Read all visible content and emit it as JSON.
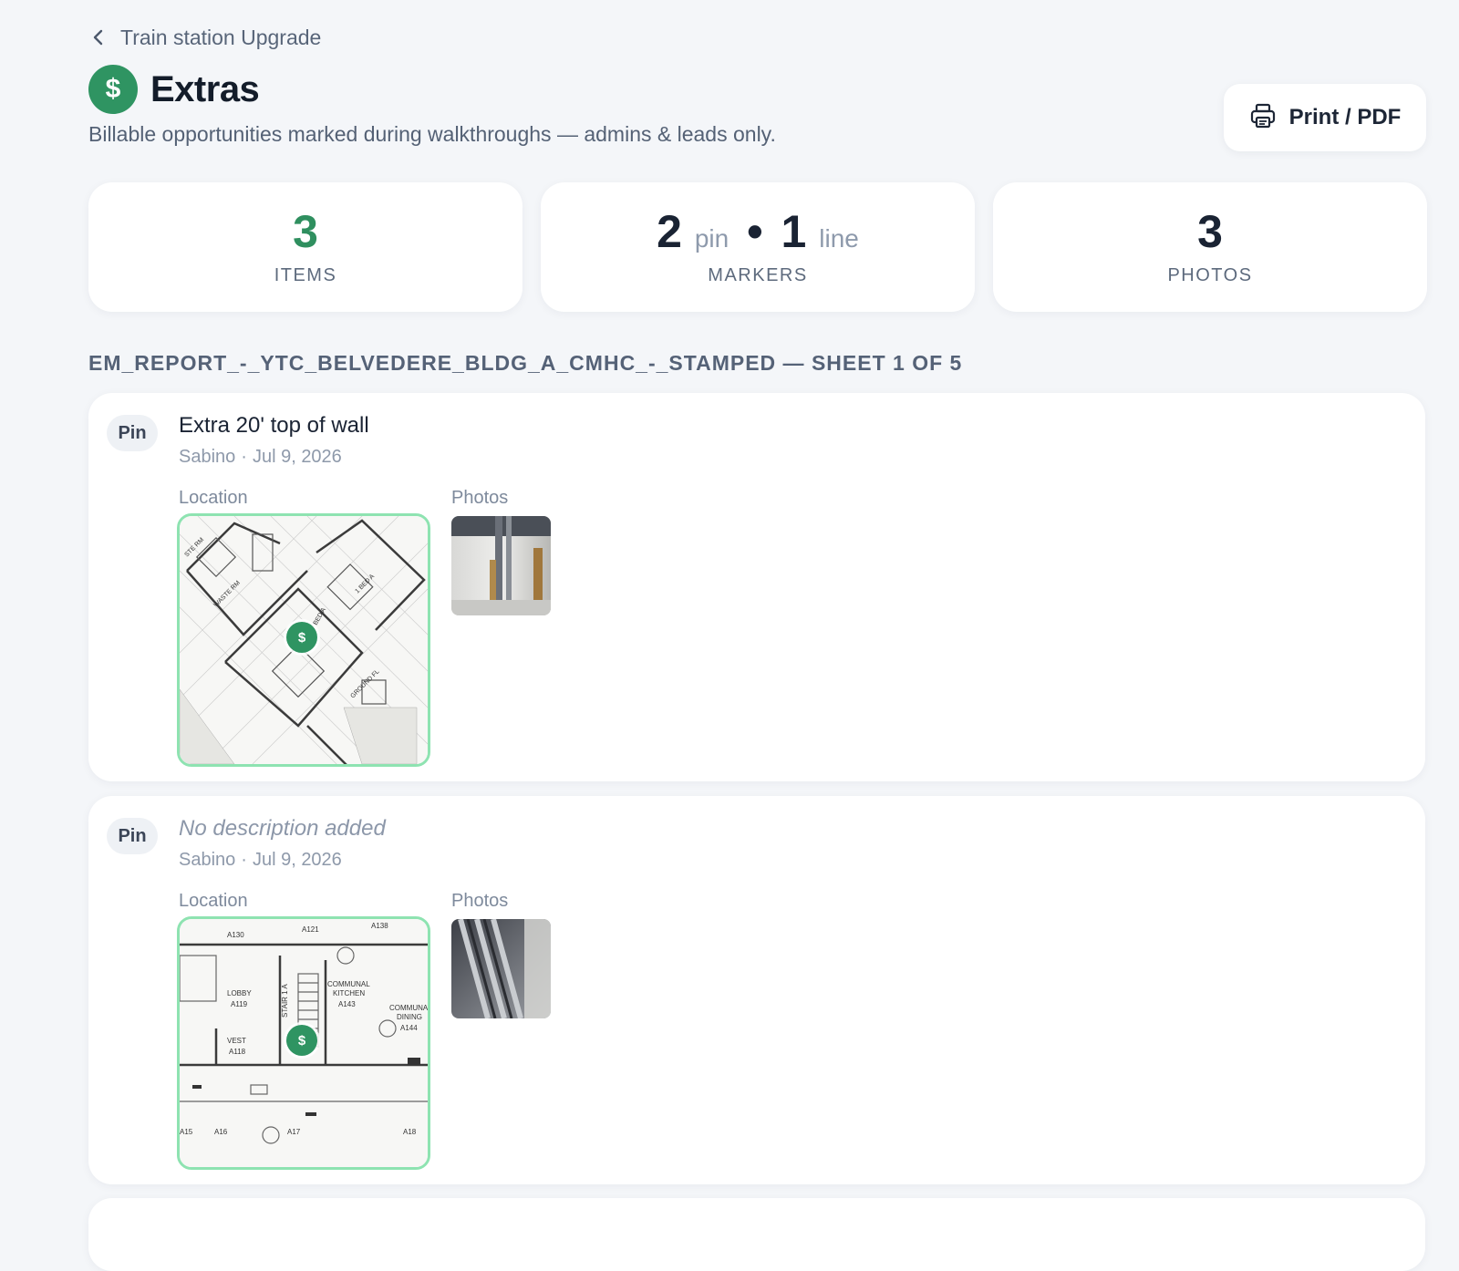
{
  "nav": {
    "back_label": "Train station Upgrade",
    "back_icon": "chevron-left-icon"
  },
  "header": {
    "icon_symbol": "$",
    "title": "Extras",
    "subtitle": "Billable opportunities marked during walkthroughs — admins & leads only.",
    "print_label": "Print / PDF",
    "print_icon": "printer-icon"
  },
  "stats": {
    "items": {
      "value": "3",
      "label": "ITEMS"
    },
    "markers": {
      "pin_count": "2",
      "pin_unit": "pin",
      "separator": "•",
      "line_count": "1",
      "line_unit": "line",
      "label": "MARKERS"
    },
    "photos": {
      "value": "3",
      "label": "PHOTOS"
    }
  },
  "sheet_heading": "EM_REPORT_-_YTC_BELVEDERE_BLDG_A_CMHC_-_STAMPED — SHEET 1 OF 5",
  "extras": [
    {
      "type": "Pin",
      "description": "Extra 20' top of wall",
      "author": "Sabino",
      "separator": "·",
      "date": "Jul 9, 2026",
      "location_label": "Location",
      "photos_label": "Photos",
      "marker_symbol": "$"
    },
    {
      "type": "Pin",
      "description": "No description added",
      "author": "Sabino",
      "separator": "·",
      "date": "Jul 9, 2026",
      "location_label": "Location",
      "photos_label": "Photos",
      "marker_symbol": "$",
      "plan_labels": [
        "LOBBY",
        "A119",
        "COMMUNAL",
        "KITCHEN",
        "A143",
        "STAIR 1 A",
        "VEST",
        "A118",
        "A130",
        "A121",
        "A138",
        "COMMUNAL",
        "DINING",
        "A144",
        "A15",
        "A16",
        "A17",
        "A18"
      ]
    }
  ],
  "colors": {
    "accent_green": "#2f9462",
    "map_border": "#8ee3b1",
    "background": "#f4f6f9"
  }
}
